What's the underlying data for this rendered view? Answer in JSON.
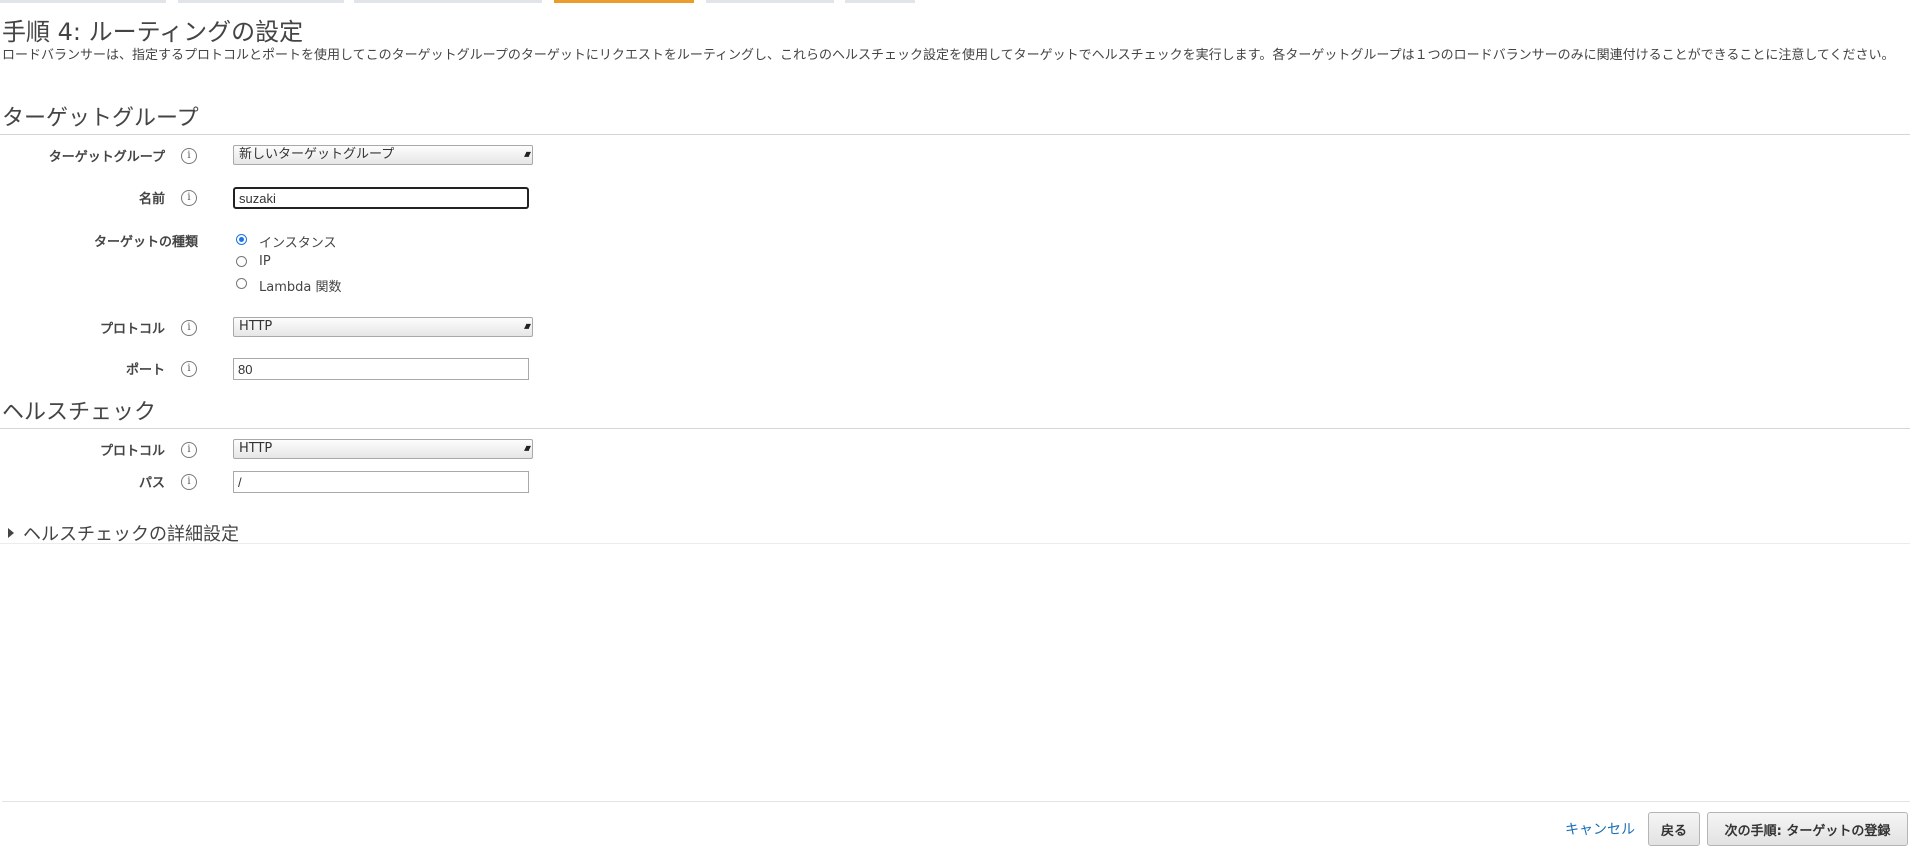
{
  "wizard": {
    "step_count": 7,
    "active_step": 4
  },
  "page": {
    "title": "手順 4: ルーティングの設定",
    "description": "ロードバランサーは、指定するプロトコルとポートを使用してこのターゲットグループのターゲットにリクエストをルーティングし、これらのヘルスチェック設定を使用してターゲットでヘルスチェックを実行します。各ターゲットグループは１つのロードバランサーのみに関連付けることができることに注意してください。"
  },
  "target_group_section": {
    "heading": "ターゲットグループ",
    "target_group": {
      "label": "ターゲットグループ",
      "selected": "新しいターゲットグループ"
    },
    "name": {
      "label": "名前",
      "value": "suzaki"
    },
    "target_type": {
      "label": "ターゲットの種類",
      "options": [
        {
          "label": "インスタンス",
          "checked": true
        },
        {
          "label": "IP",
          "checked": false
        },
        {
          "label": "Lambda 関数",
          "checked": false
        }
      ]
    },
    "protocol": {
      "label": "プロトコル",
      "selected": "HTTP"
    },
    "port": {
      "label": "ポート",
      "value": "80"
    }
  },
  "health_check_section": {
    "heading": "ヘルスチェック",
    "protocol": {
      "label": "プロトコル",
      "selected": "HTTP"
    },
    "path": {
      "label": "パス",
      "value": "/"
    },
    "advanced_label": "ヘルスチェックの詳細設定"
  },
  "footer": {
    "cancel_label": "キャンセル",
    "back_label": "戻る",
    "next_label": "次の手順: ターゲットの登録"
  },
  "colors": {
    "active_step": "#ec9c2a",
    "link": "#1a6fb8",
    "radio_checked": "#1a73e8"
  }
}
